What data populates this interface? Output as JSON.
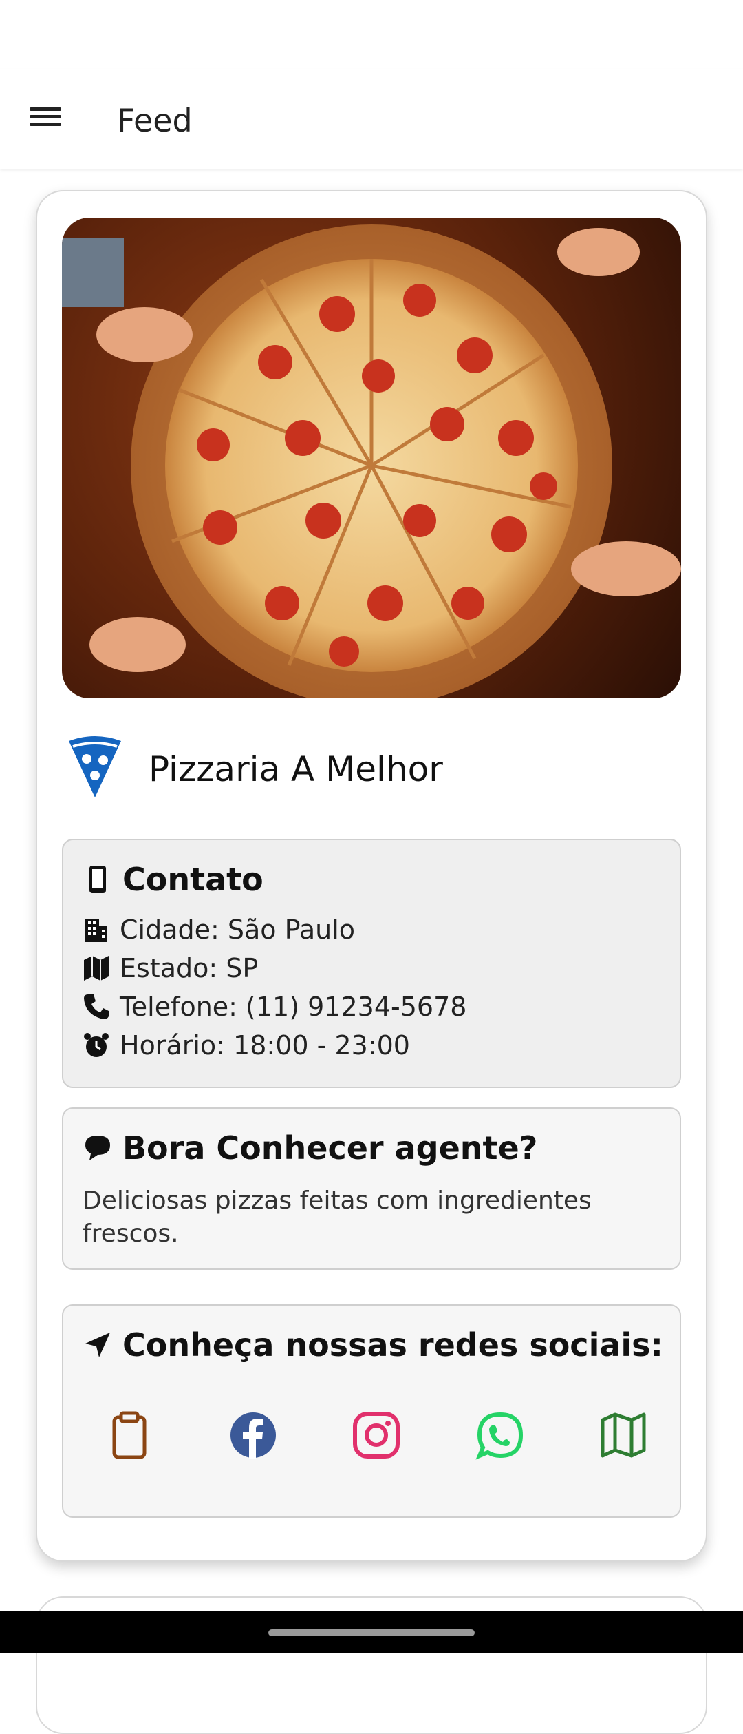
{
  "app_bar": {
    "title": "Feed",
    "menu_icon": "menu-icon"
  },
  "shop": {
    "name": "Pizzaria A Melhor",
    "logo_icon": "pizza-slice-icon",
    "logo_color": "#1565C0",
    "image_description_icon": "pizza-photo"
  },
  "contact": {
    "title": "Contato",
    "title_icon": "phone-device-icon",
    "rows": [
      {
        "icon": "building-icon",
        "text": "Cidade: São Paulo"
      },
      {
        "icon": "map-icon",
        "text": "Estado: SP"
      },
      {
        "icon": "phone-icon",
        "text": "Telefone: (11) 91234-5678"
      },
      {
        "icon": "alarm-clock-icon",
        "text": "Horário: 18:00 - 23:00"
      }
    ]
  },
  "about": {
    "title": "Bora Conhecer agente?",
    "title_icon": "chat-bubble-icon",
    "text": "Deliciosas pizzas feitas com ingredientes frescos."
  },
  "social": {
    "title": "Conheça nossas redes sociais:",
    "title_icon": "send-icon",
    "items": [
      {
        "icon": "clipboard-icon",
        "color": "#8B4513"
      },
      {
        "icon": "facebook-icon",
        "color": "#3B5998"
      },
      {
        "icon": "instagram-icon",
        "color": "#E1306C"
      },
      {
        "icon": "whatsapp-icon",
        "color": "#25D366"
      },
      {
        "icon": "map-icon",
        "color": "#2E7D32"
      }
    ]
  }
}
